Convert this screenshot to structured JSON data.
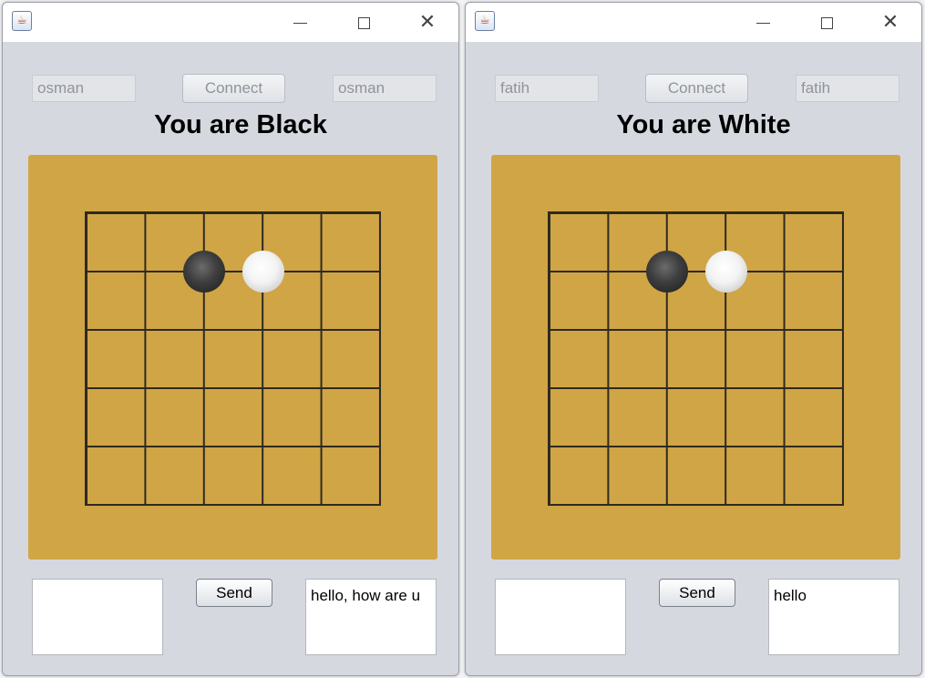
{
  "windows": [
    {
      "player_name": "osman",
      "connect_label": "Connect",
      "opponent_name": "osman",
      "status_title": "You are Black",
      "board": {
        "size": 5,
        "stones": [
          {
            "color": "black",
            "col": 2,
            "row": 1
          },
          {
            "color": "white",
            "col": 3,
            "row": 1
          }
        ]
      },
      "message_input": "",
      "send_label": "Send",
      "chat_text": "hello, how are u"
    },
    {
      "player_name": "fatih",
      "connect_label": "Connect",
      "opponent_name": "fatih",
      "status_title": "You are White",
      "board": {
        "size": 5,
        "stones": [
          {
            "color": "black",
            "col": 2,
            "row": 1
          },
          {
            "color": "white",
            "col": 3,
            "row": 1
          }
        ]
      },
      "message_input": "",
      "send_label": "Send",
      "chat_text": "hello"
    }
  ],
  "icons": {
    "app": "java-cup-icon",
    "minimize": "minimize-icon",
    "maximize": "maximize-icon",
    "close": "close-icon"
  },
  "colors": {
    "board": "#d0a545",
    "window_bg": "#d5d8df",
    "grid_line": "#2e2a22"
  }
}
